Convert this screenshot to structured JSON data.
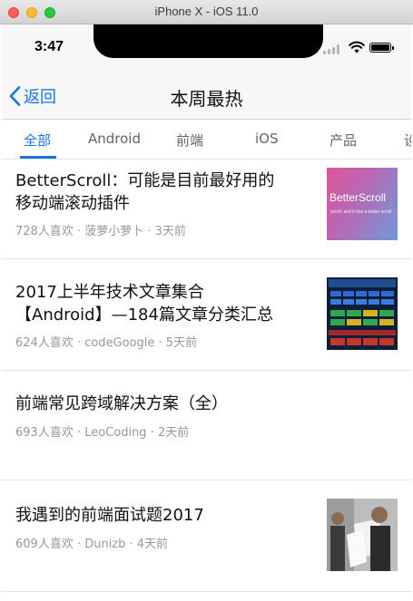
{
  "window": {
    "title": "iPhone X - iOS 11.0"
  },
  "status_bar": {
    "time": "3:47"
  },
  "nav": {
    "back_label": "返回",
    "title": "本周最热"
  },
  "tabs": [
    {
      "label": "全部",
      "active": true
    },
    {
      "label": "Android",
      "active": false
    },
    {
      "label": "前端",
      "active": false
    },
    {
      "label": "iOS",
      "active": false
    },
    {
      "label": "产品",
      "active": false
    },
    {
      "label": "设",
      "active": false
    }
  ],
  "articles": [
    {
      "title": "BetterScroll：可能是目前最好用的移动端滚动插件",
      "meta": "728人喜欢 · 菠萝小萝卜 · 3天前",
      "thumbnail": {
        "text": "BetterScroll",
        "subtext": "scroll, and it has a better scroll"
      }
    },
    {
      "title": "2017上半年技术文章集合【Android】—184篇文章分类汇总",
      "meta": "624人喜欢 · codeGoogle · 5天前"
    },
    {
      "title": "前端常见跨域解决方案（全）",
      "meta": "693人喜欢 · LeoCoding · 2天前"
    },
    {
      "title": "我遇到的前端面试题2017",
      "meta": "609人喜欢 · Dunizb · 4天前"
    }
  ],
  "colors": {
    "accent": "#1a73e8",
    "meta_text": "#999999"
  }
}
